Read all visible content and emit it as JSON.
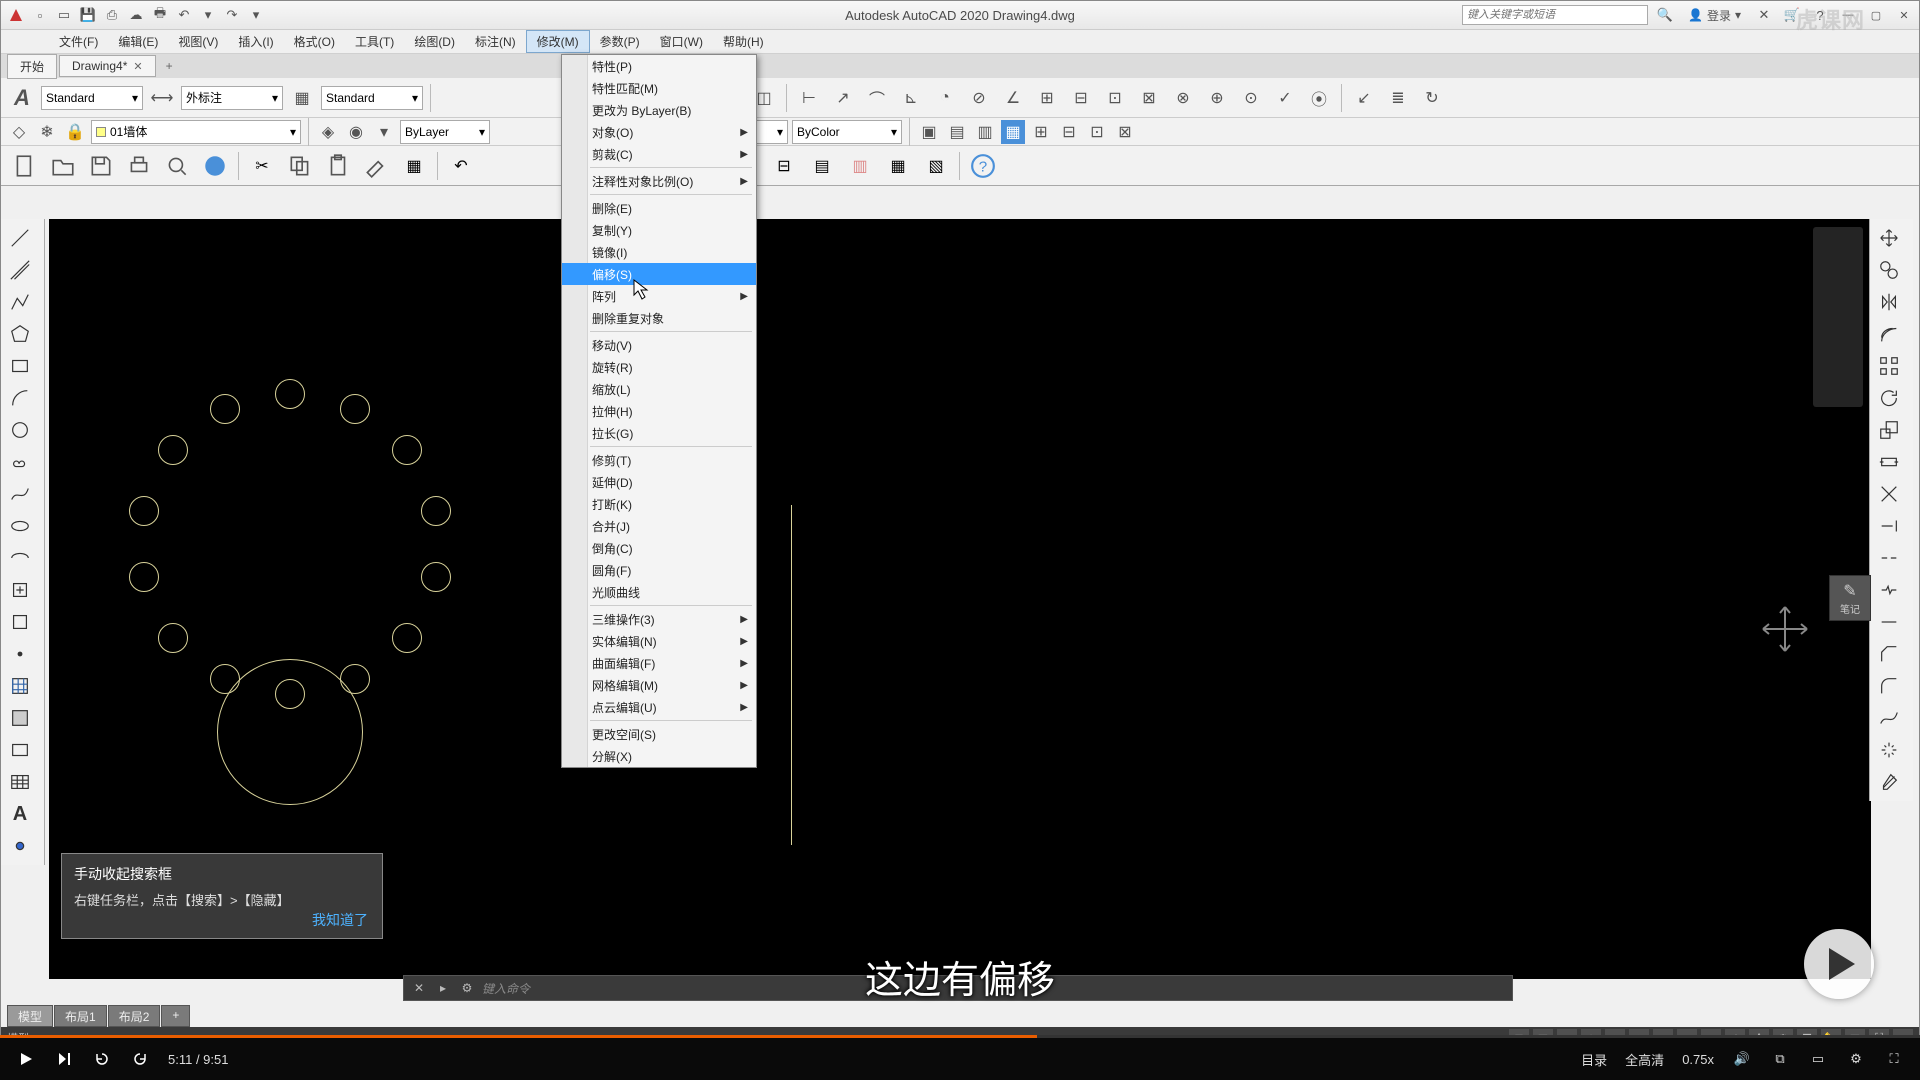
{
  "app": {
    "title_full": "Autodesk AutoCAD 2020   Drawing4.dwg",
    "search_placeholder": "键入关键字或短语",
    "login_label": "登录",
    "watermark": "虎课网"
  },
  "menus": [
    "文件(F)",
    "编辑(E)",
    "视图(V)",
    "插入(I)",
    "格式(O)",
    "工具(T)",
    "绘图(D)",
    "标注(N)",
    "修改(M)",
    "参数(P)",
    "窗口(W)",
    "帮助(H)"
  ],
  "active_menu_index": 8,
  "doc_tabs": {
    "start": "开始",
    "current": "Drawing4*",
    "add": "+"
  },
  "ribbon": {
    "text_style": "Standard",
    "dim_style": "外标注",
    "table_style": "Standard",
    "layer": "01墙体",
    "linetype": "ByLayer",
    "color": "ByColor"
  },
  "dropdown": {
    "items": [
      {
        "label": "特性(P)"
      },
      {
        "label": "特性匹配(M)"
      },
      {
        "label": "更改为 ByLayer(B)"
      },
      {
        "label": "对象(O)",
        "submenu": true
      },
      {
        "label": "剪裁(C)",
        "submenu": true
      },
      {
        "sep": true
      },
      {
        "label": "注释性对象比例(O)",
        "submenu": true
      },
      {
        "sep": true
      },
      {
        "label": "删除(E)"
      },
      {
        "label": "复制(Y)"
      },
      {
        "label": "镜像(I)"
      },
      {
        "label": "偏移(S)",
        "highlighted": true
      },
      {
        "label": "阵列",
        "submenu": true
      },
      {
        "label": "删除重复对象"
      },
      {
        "sep": true
      },
      {
        "label": "移动(V)"
      },
      {
        "label": "旋转(R)"
      },
      {
        "label": "缩放(L)"
      },
      {
        "label": "拉伸(H)"
      },
      {
        "label": "拉长(G)"
      },
      {
        "sep": true
      },
      {
        "label": "修剪(T)"
      },
      {
        "label": "延伸(D)"
      },
      {
        "label": "打断(K)"
      },
      {
        "label": "合并(J)"
      },
      {
        "label": "倒角(C)"
      },
      {
        "label": "圆角(F)"
      },
      {
        "label": "光顺曲线"
      },
      {
        "sep": true
      },
      {
        "label": "三维操作(3)",
        "submenu": true
      },
      {
        "label": "实体编辑(N)",
        "submenu": true
      },
      {
        "label": "曲面编辑(F)",
        "submenu": true
      },
      {
        "label": "网格编辑(M)",
        "submenu": true
      },
      {
        "label": "点云编辑(U)",
        "submenu": true
      },
      {
        "sep": true
      },
      {
        "label": "更改空间(S)"
      },
      {
        "label": "分解(X)"
      }
    ]
  },
  "tooltip": {
    "title": "手动收起搜索框",
    "body": "右键任务栏，点击【搜索】>【隐藏】",
    "ok": "我知道了"
  },
  "cmd_placeholder": "键入命令",
  "bottom_tabs": [
    "模型",
    "布局1",
    "布局2",
    "+"
  ],
  "status_model": "模型",
  "subtitle": "这边有偏移",
  "pen_label": "笔记",
  "player": {
    "time": "5:11 / 9:51",
    "catalog": "目录",
    "quality": "全高清",
    "speed": "0.75x"
  }
}
